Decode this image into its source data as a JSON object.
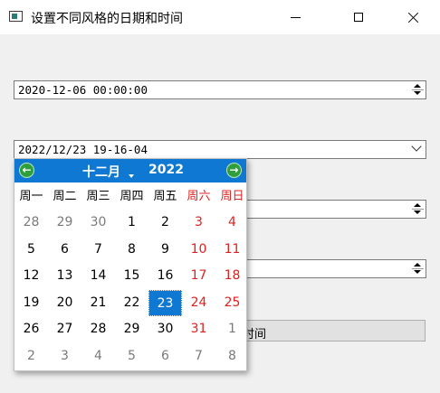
{
  "window": {
    "title": "设置不同风格的日期和时间"
  },
  "fields": {
    "datetime1": "2020-12-06 00:00:00",
    "datetime2": "2022/12/23 19-16-04"
  },
  "button": {
    "visible_label": "时间"
  },
  "calendar": {
    "month_label": "十二月",
    "year_label": "2022",
    "prev_glyph": "←",
    "next_glyph": "→",
    "weekdays": [
      "周一",
      "周二",
      "周三",
      "周四",
      "周五",
      "周六",
      "周日"
    ],
    "weeks": [
      [
        "28",
        "29",
        "30",
        "1",
        "2",
        "3",
        "4"
      ],
      [
        "5",
        "6",
        "7",
        "8",
        "9",
        "10",
        "11"
      ],
      [
        "12",
        "13",
        "14",
        "15",
        "16",
        "17",
        "18"
      ],
      [
        "19",
        "20",
        "21",
        "22",
        "23",
        "24",
        "25"
      ],
      [
        "26",
        "27",
        "28",
        "29",
        "30",
        "31",
        "1"
      ],
      [
        "2",
        "3",
        "4",
        "5",
        "6",
        "7",
        "8"
      ]
    ],
    "selected_day": "23",
    "colors": {
      "header": "#0f78d2",
      "weekend": "#e02020",
      "other_month": "#7a7a7a",
      "nav_button": "#2f9e3c"
    }
  }
}
